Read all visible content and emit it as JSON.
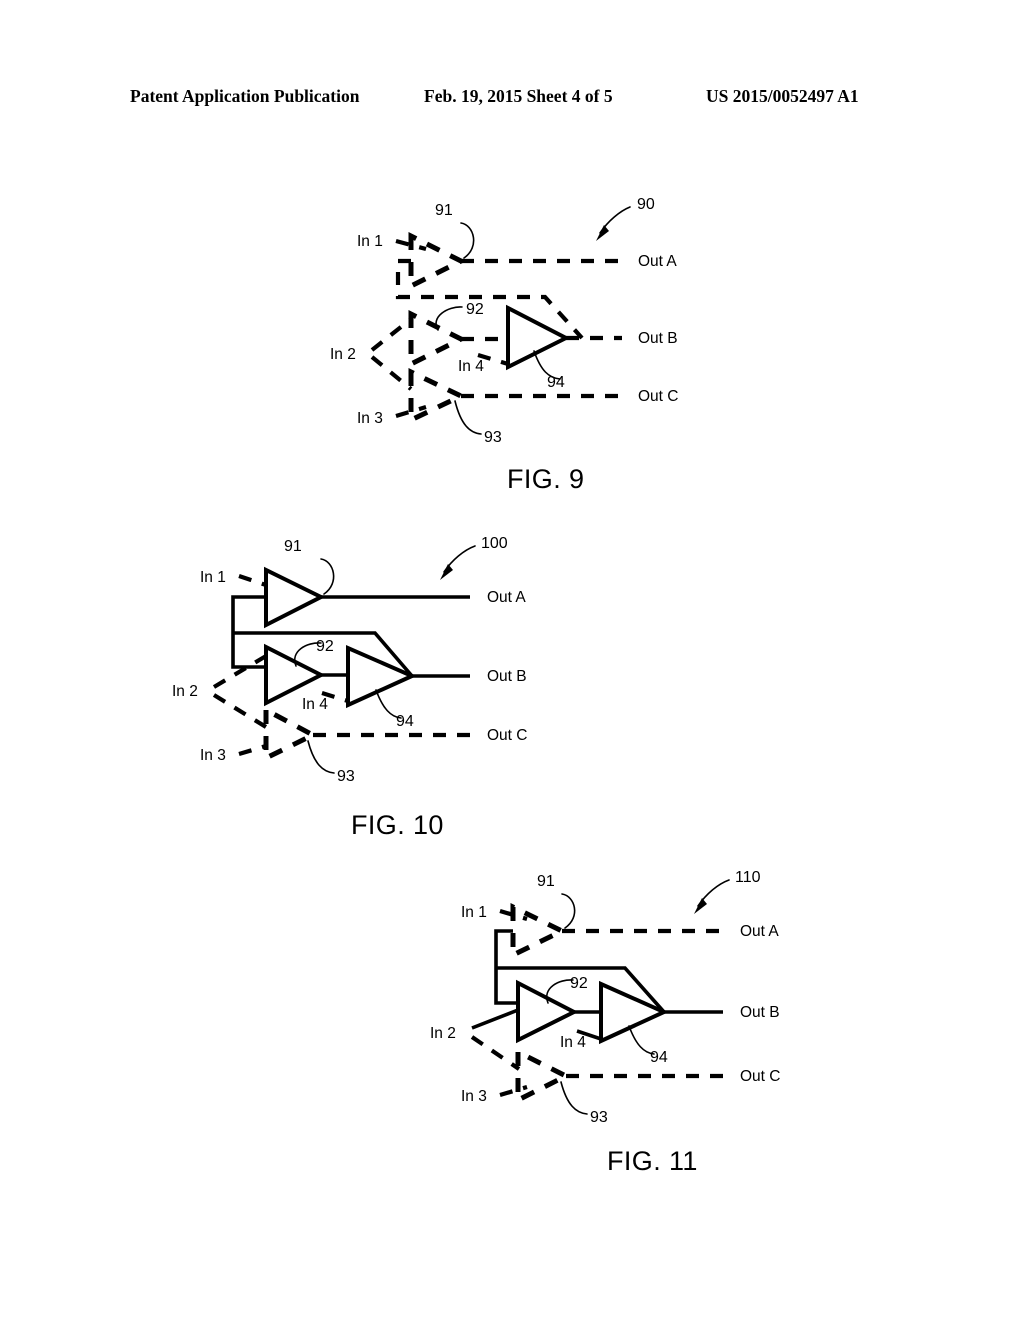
{
  "header": {
    "left": "Patent Application Publication",
    "middle": "Feb. 19, 2015  Sheet 4 of 5",
    "right": "US 2015/0052497 A1"
  },
  "colors": {
    "ink": "#000000",
    "paper": "#ffffff"
  },
  "figures": [
    {
      "id": "fig9",
      "caption": "FIG. 9",
      "system_ref": "90",
      "inputs": [
        "In 1",
        "In 2",
        "In 3",
        "In 4"
      ],
      "outputs": [
        "Out A",
        "Out B",
        "Out C"
      ],
      "blocks": [
        {
          "ref": "91",
          "kind": "amplifier",
          "state": "inactive",
          "output": "Out A"
        },
        {
          "ref": "92",
          "kind": "amplifier",
          "state": "inactive",
          "output": "Out B"
        },
        {
          "ref": "93",
          "kind": "amplifier",
          "state": "inactive",
          "output": "Out C"
        },
        {
          "ref": "94",
          "kind": "amplifier",
          "state": "active",
          "output": "Out B"
        }
      ]
    },
    {
      "id": "fig10",
      "caption": "FIG. 10",
      "system_ref": "100",
      "inputs": [
        "In 1",
        "In 2",
        "In 3",
        "In 4"
      ],
      "outputs": [
        "Out A",
        "Out B",
        "Out C"
      ],
      "blocks": [
        {
          "ref": "91",
          "kind": "amplifier",
          "state": "active",
          "output": "Out A"
        },
        {
          "ref": "92",
          "kind": "amplifier",
          "state": "active",
          "output": "Out B"
        },
        {
          "ref": "93",
          "kind": "amplifier",
          "state": "inactive",
          "output": "Out C"
        },
        {
          "ref": "94",
          "kind": "amplifier",
          "state": "active",
          "output": "Out B"
        }
      ]
    },
    {
      "id": "fig11",
      "caption": "FIG. 11",
      "system_ref": "110",
      "inputs": [
        "In 1",
        "In 2",
        "In 3",
        "In 4"
      ],
      "outputs": [
        "Out A",
        "Out B",
        "Out C"
      ],
      "blocks": [
        {
          "ref": "91",
          "kind": "amplifier",
          "state": "inactive",
          "output": "Out A"
        },
        {
          "ref": "92",
          "kind": "amplifier",
          "state": "active",
          "output": "Out B"
        },
        {
          "ref": "93",
          "kind": "amplifier",
          "state": "inactive",
          "output": "Out C"
        },
        {
          "ref": "94",
          "kind": "amplifier",
          "state": "active",
          "output": "Out B"
        }
      ]
    }
  ]
}
